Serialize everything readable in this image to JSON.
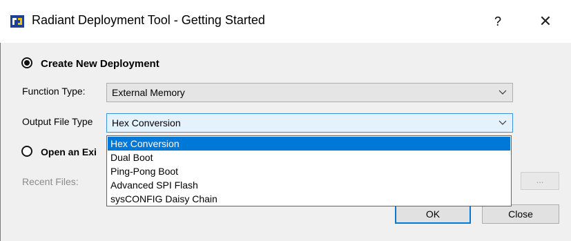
{
  "window": {
    "title": "Radiant Deployment Tool - Getting Started",
    "help_label": "?",
    "close_label": "✕"
  },
  "create_new": {
    "label": "Create New Deployment",
    "checked": true
  },
  "function_type": {
    "label": "Function Type:",
    "value": "External Memory"
  },
  "output_file_type": {
    "label": "Output File Type",
    "value": "Hex Conversion",
    "options": [
      "Hex Conversion",
      "Dual Boot",
      "Ping-Pong Boot",
      "Advanced SPI Flash",
      "sysCONFIG Daisy Chain"
    ],
    "selected_index": 0
  },
  "open_existing": {
    "label": "Open an Exi",
    "checked": false
  },
  "recent_files": {
    "label": "Recent Files:",
    "browse_label": "..."
  },
  "buttons": {
    "ok_label": "OK",
    "close_label": "Close"
  },
  "colors": {
    "selection": "#0078d7",
    "app_icon": "#1e3f9a"
  }
}
